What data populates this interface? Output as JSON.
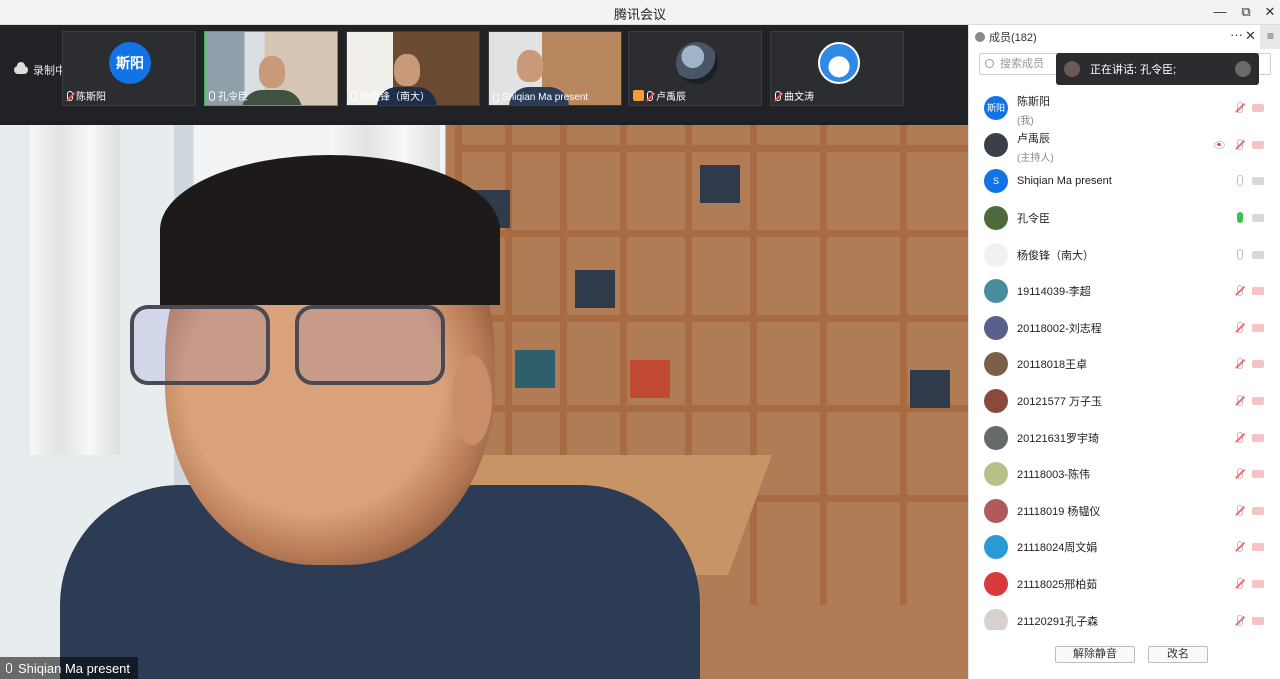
{
  "window": {
    "title": "腾讯会议",
    "minimize": "—",
    "maximize": "⧉",
    "close": "✕"
  },
  "strip": {
    "recording_label": "录制中",
    "thumbnails": [
      {
        "name": "陈斯阳",
        "avatar_text": "斯阳"
      },
      {
        "name": "孔令臣"
      },
      {
        "name": "杨俊锋（南大）"
      },
      {
        "name": "Shiqian Ma present"
      },
      {
        "name": "卢禹辰"
      },
      {
        "name": "曲文涛"
      }
    ]
  },
  "main_video": {
    "speaker_label": "Shiqian Ma present"
  },
  "panel": {
    "title": "成员(182)",
    "more": "···",
    "close": "✕",
    "menu": "≡",
    "search_placeholder": "搜索成员",
    "talking_label": "正在讲话: 孔令臣;",
    "members": [
      {
        "name": "陈斯阳",
        "role": "(我)",
        "avatar_text": "斯阳",
        "avatar_color": "#1273e5",
        "mic": "muted",
        "camera": "off"
      },
      {
        "name": "卢禹辰",
        "role": "(主持人)",
        "avatar_text": "",
        "avatar_color": "#3b3f4a",
        "mic": "muted",
        "camera": "off",
        "recording": true
      },
      {
        "name": "Shiqian Ma present",
        "avatar_text": "S",
        "avatar_color": "#1273e5",
        "mic": "on",
        "camera": "grey"
      },
      {
        "name": "孔令臣",
        "avatar_text": "",
        "avatar_color": "#4d6a3c",
        "mic": "speaking",
        "camera": "grey"
      },
      {
        "name": "杨俊锋（南大）",
        "avatar_text": "",
        "avatar_color": "#f1f1f1",
        "mic": "on",
        "camera": "grey"
      },
      {
        "name": "19114039-李超",
        "avatar_text": "",
        "avatar_color": "#4a8c9c",
        "mic": "muted",
        "camera": "off"
      },
      {
        "name": "20118002-刘志程",
        "avatar_text": "",
        "avatar_color": "#5a5f8c",
        "mic": "muted",
        "camera": "off"
      },
      {
        "name": "20118018王卓",
        "avatar_text": "",
        "avatar_color": "#7a6048",
        "mic": "muted",
        "camera": "off"
      },
      {
        "name": "20121577 万子玉",
        "avatar_text": "",
        "avatar_color": "#8a4a3a",
        "mic": "muted",
        "camera": "off"
      },
      {
        "name": "20121631罗宇琦",
        "avatar_text": "",
        "avatar_color": "#666a66",
        "mic": "muted",
        "camera": "off"
      },
      {
        "name": "21118003-陈伟",
        "avatar_text": "",
        "avatar_color": "#b7c28a",
        "mic": "muted",
        "camera": "off"
      },
      {
        "name": "21118019 杨韫仪",
        "avatar_text": "",
        "avatar_color": "#b05a5a",
        "mic": "muted",
        "camera": "off"
      },
      {
        "name": "21118024周文娟",
        "avatar_text": "",
        "avatar_color": "#2a9ad6",
        "mic": "muted",
        "camera": "off"
      },
      {
        "name": "21118025邢柏茹",
        "avatar_text": "",
        "avatar_color": "#d83a3a",
        "mic": "muted",
        "camera": "off"
      },
      {
        "name": "21120291孔子森",
        "avatar_text": "",
        "avatar_color": "#d7d0ce",
        "mic": "muted",
        "camera": "off"
      }
    ],
    "unmute_all_label": "解除静音",
    "rename_label": "改名"
  }
}
